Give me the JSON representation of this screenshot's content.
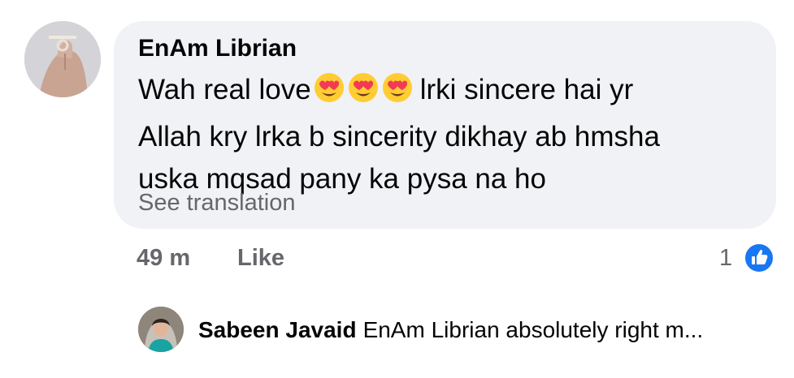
{
  "comment": {
    "author": "EnAm Librian",
    "text_before_emoji": "Wah real love",
    "emoji": [
      "heart-eyes-emoji",
      "heart-eyes-emoji",
      "heart-eyes-emoji"
    ],
    "text_after_emoji": "lrki sincere hai yr",
    "line2": "Allah kry lrka b sincerity dikhay ab hmsha",
    "line3": "uska mqsad pany ka pysa na ho",
    "see_translation": "See translation",
    "time": "49 m",
    "like_label": "Like",
    "reaction_count": "1"
  },
  "reply": {
    "author": "Sabeen Javaid",
    "preview": "EnAm Librian absolutely right m..."
  },
  "colors": {
    "bubble_bg": "#f0f2f5",
    "meta_text": "#65676b",
    "like_blue": "#1877f2"
  }
}
